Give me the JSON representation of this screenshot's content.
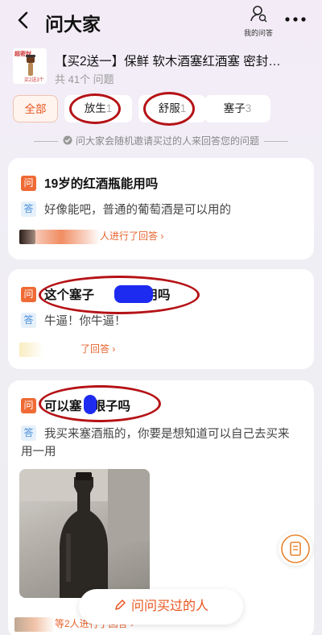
{
  "header": {
    "title": "问大家",
    "my_questions": "我的问答"
  },
  "product": {
    "title": "【买2送一】保鲜 软木酒塞红酒塞 密封…",
    "count": "共 41个 问题",
    "img_tag": "超密封",
    "img_sub": "买2送3个"
  },
  "chips": [
    {
      "label": "全部",
      "count": ""
    },
    {
      "label": "放生",
      "count": "1"
    },
    {
      "label": "舒服",
      "count": "1"
    },
    {
      "label": "塞子",
      "count": "3"
    }
  ],
  "notice": "问大家会随机邀请买过的人来回答您的问题",
  "badges": {
    "q": "问",
    "a": "答"
  },
  "cards": [
    {
      "question": "19岁的红酒瓶能用吗",
      "answer": "好像能吧，普通的葡萄酒是可以用的",
      "footer": "人进行了回答 ›"
    },
    {
      "question": "这个塞子",
      "question_tail": "能用吗",
      "answer": "牛逼！你牛逼！",
      "footer": "了回答 ›"
    },
    {
      "question": "可以塞",
      "question_tail": "眼子吗",
      "answer": "我买来塞酒瓶的，你要是想知道可以自己去买来用一用",
      "footer": "等2人进行了回答 ›"
    }
  ],
  "ask_button": "问问买过的人",
  "colors": {
    "accent": "#e8541e",
    "circle": "#b51216",
    "redact": "#1d2bf0"
  }
}
